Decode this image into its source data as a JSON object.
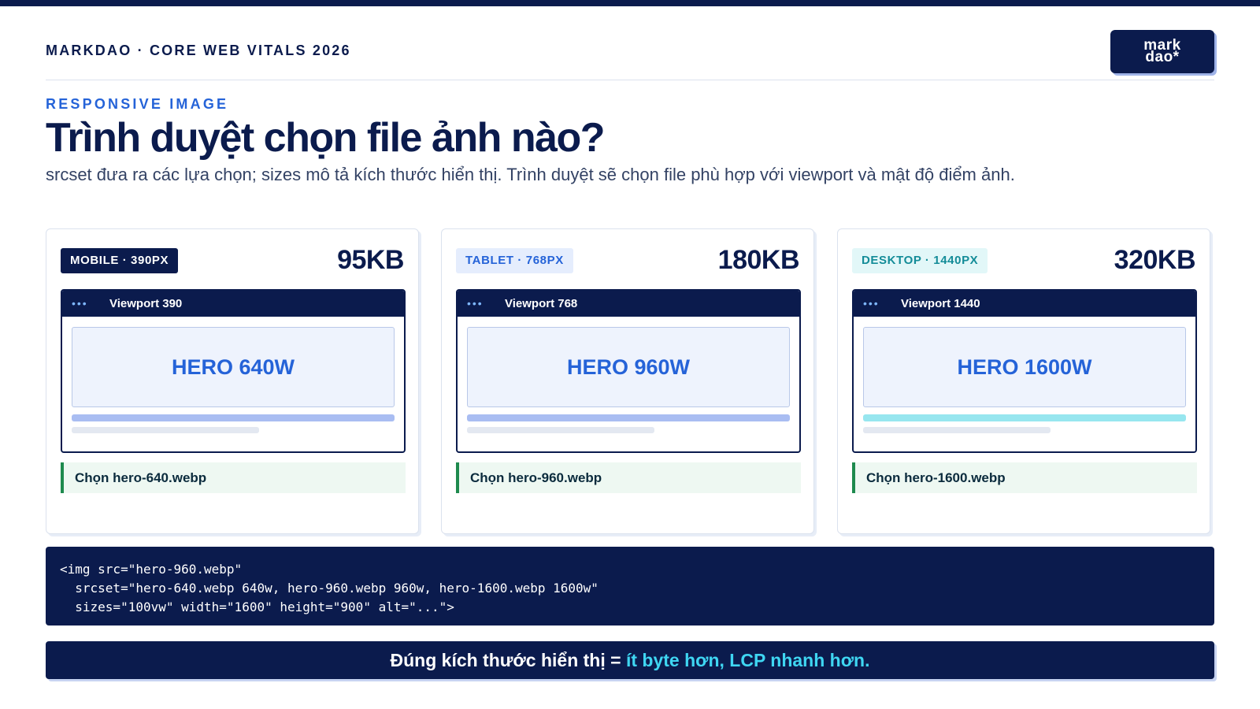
{
  "header": {
    "brand": "MARKDAO · CORE WEB VITALS 2026",
    "logo_line1": "mark",
    "logo_line2": "dao*"
  },
  "hero_section": {
    "eyebrow": "RESPONSIVE IMAGE",
    "title": "Trình duyệt chọn file ảnh nào?",
    "subtitle": "srcset đưa ra các lựa chọn; sizes mô tả kích thước hiển thị. Trình duyệt sẽ chọn file phù hợp với viewport và mật độ điểm ảnh."
  },
  "cards": [
    {
      "badge": "MOBILE · 390PX",
      "size": "95KB",
      "dots": "•••",
      "viewport": "Viewport 390",
      "hero_label": "HERO 640W",
      "choice": "Chọn hero-640.webp"
    },
    {
      "badge": "TABLET · 768PX",
      "size": "180KB",
      "dots": "•••",
      "viewport": "Viewport 768",
      "hero_label": "HERO 960W",
      "choice": "Chọn hero-960.webp"
    },
    {
      "badge": "DESKTOP · 1440PX",
      "size": "320KB",
      "dots": "•••",
      "viewport": "Viewport 1440",
      "hero_label": "HERO 1600W",
      "choice": "Chọn hero-1600.webp"
    }
  ],
  "code": {
    "line1": "<img src=\"hero-960.webp\"",
    "line2": "  srcset=\"hero-640.webp 640w, hero-960.webp 960w, hero-1600.webp 1600w\"",
    "line3": "  sizes=\"100vw\" width=\"1600\" height=\"900\" alt=\"...\">"
  },
  "banner": {
    "text_main": "Đúng kích thước hiển thị = ",
    "text_highlight": "ít byte hơn, LCP nhanh hơn."
  },
  "colors": {
    "navy": "#0b1b4d",
    "accent_blue": "#2563d8",
    "accent_cyan": "#3fd6f2",
    "success_green": "#1e8a4e"
  }
}
